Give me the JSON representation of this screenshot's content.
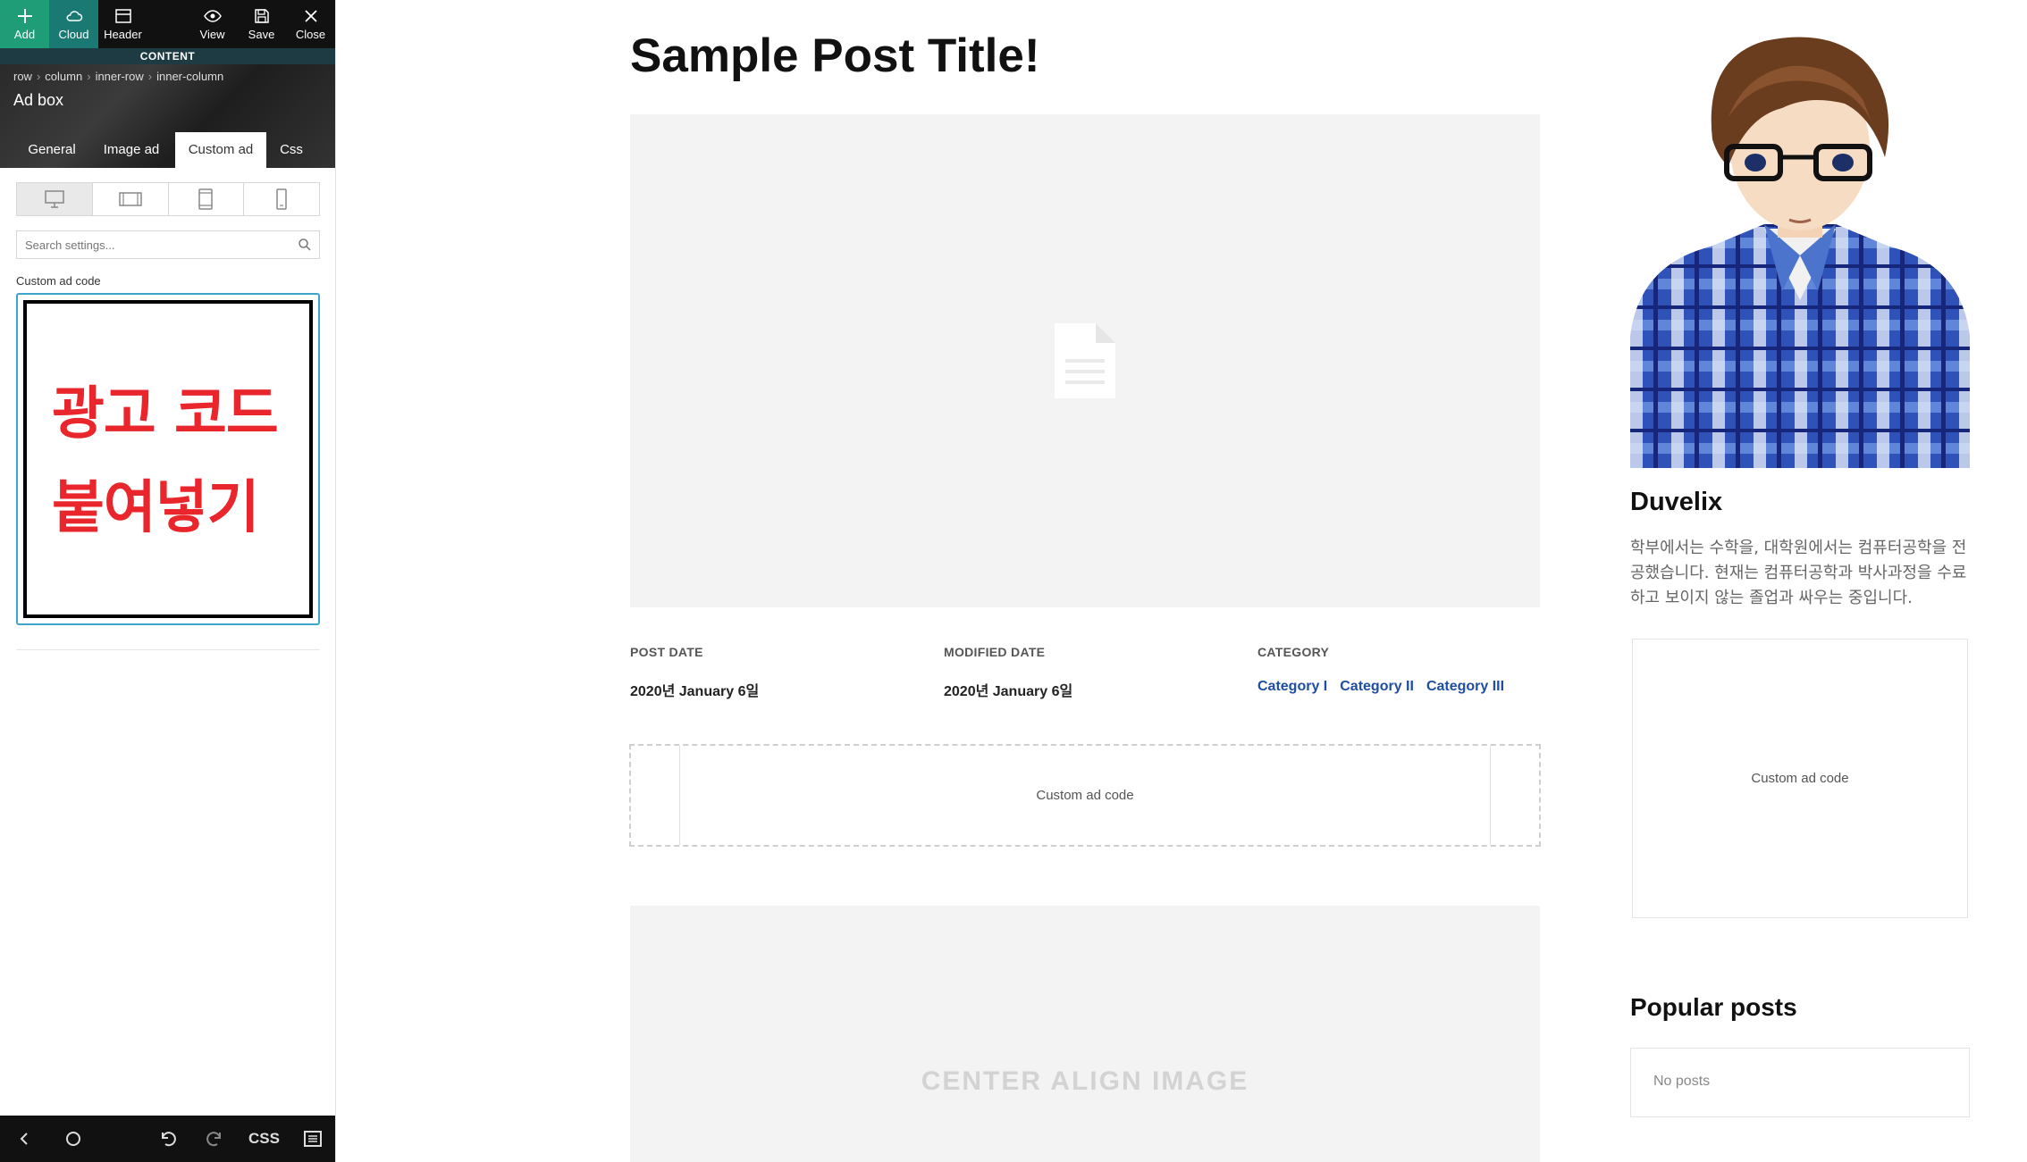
{
  "toolbar": {
    "add": "Add",
    "cloud": "Cloud",
    "header": "Header",
    "view": "View",
    "save": "Save",
    "close": "Close"
  },
  "panel": {
    "section": "CONTENT",
    "breadcrumb": [
      "row",
      "column",
      "inner-row",
      "inner-column"
    ],
    "element_title": "Ad box",
    "tabs": [
      "General",
      "Image ad",
      "Custom ad",
      "Css"
    ],
    "active_tab": "Custom ad",
    "devices": [
      "desktop",
      "tablet-landscape",
      "tablet-portrait",
      "mobile"
    ],
    "search_placeholder": "Search settings...",
    "field_label": "Custom ad code",
    "code_lines": [
      "광고 코드",
      "붙여넣기"
    ],
    "bottom": {
      "css": "CSS"
    }
  },
  "post": {
    "title": "Sample Post Title!",
    "meta": {
      "post_date_label": "POST DATE",
      "post_date": "2020년 January 6일",
      "modified_label": "MODIFIED DATE",
      "modified_date": "2020년 January 6일",
      "category_label": "CATEGORY",
      "categories": [
        "Category I",
        "Category II",
        "Category III"
      ]
    },
    "ad_placeholder": "Custom ad code",
    "center_image": "CENTER ALIGN IMAGE"
  },
  "sidebar": {
    "author_name": "Duvelix",
    "author_bio": "학부에서는 수학을, 대학원에서는 컴퓨터공학을 전공했습니다. 현재는 컴퓨터공학과 박사과정을 수료하고 보이지 않는 졸업과 싸우는 중입니다.",
    "ad_placeholder": "Custom ad code",
    "popular_title": "Popular posts",
    "popular_empty": "No posts"
  },
  "colors": {
    "add_green": "#1f9d76",
    "cloud_teal": "#1a7a73",
    "content_bar": "#1e3b43",
    "code_text_red": "#e8262c",
    "category_blue": "#1f4ea3"
  }
}
